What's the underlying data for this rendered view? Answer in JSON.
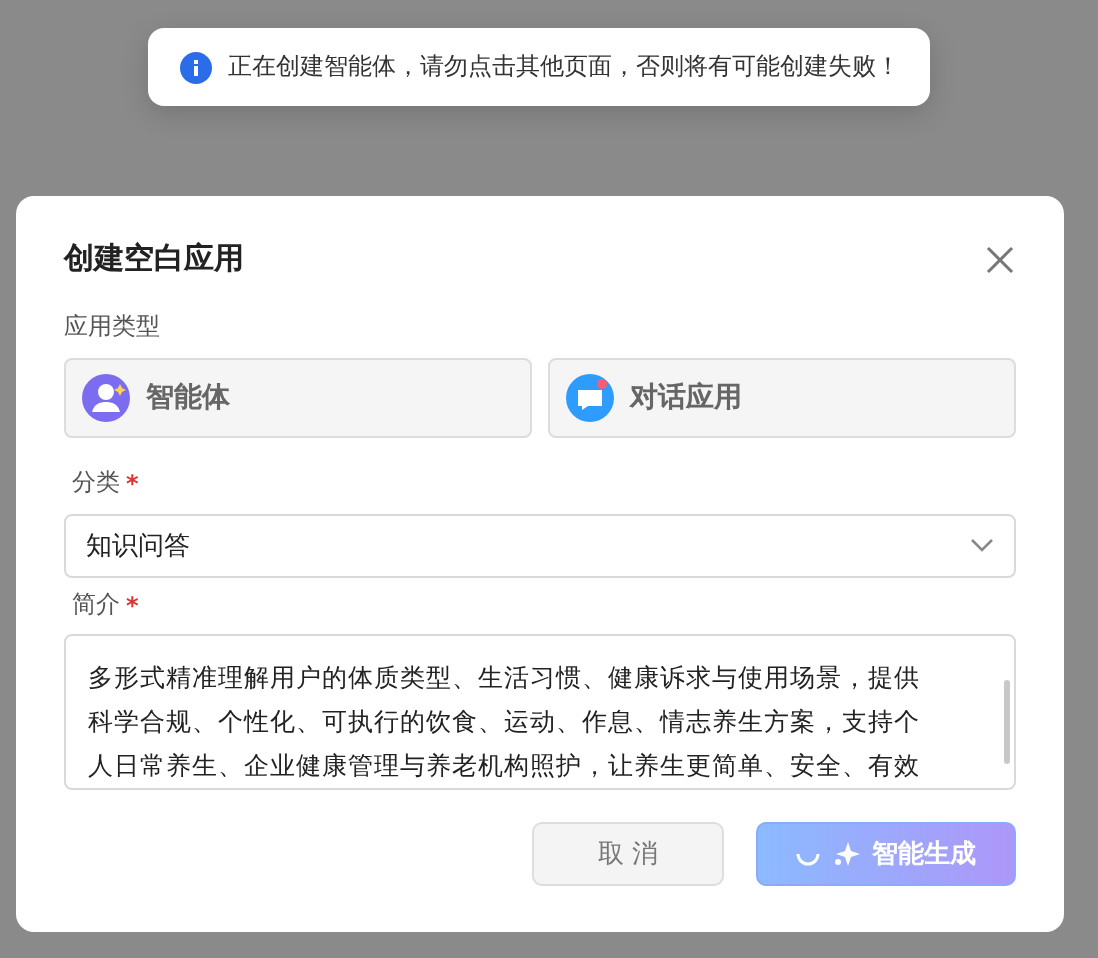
{
  "toast": {
    "message": "正在创建智能体，请勿点击其他页面，否则将有可能创建失败！"
  },
  "dialog": {
    "title": "创建空白应用",
    "app_type": {
      "label": "应用类型",
      "options": [
        {
          "kind": "agent",
          "label": "智能体",
          "selected": false
        },
        {
          "kind": "chat",
          "label": "对话应用",
          "selected": false
        }
      ]
    },
    "category": {
      "label": "分类",
      "required_mark": "*",
      "value": "知识问答"
    },
    "description": {
      "label": "简介",
      "required_mark": "*",
      "lines": [
        "多形式精准理解用户的体质类型、生活习惯、健康诉求与使用场景，提供",
        "科学合规、个性化、可执行的饮食、运动、作息、情志养生方案，支持个",
        "人日常养生、企业健康管理与养老机构照护，让养生更简单、安全、有效"
      ]
    },
    "buttons": [
      {
        "kind": "cancel",
        "label": "取 消"
      },
      {
        "kind": "generate",
        "label": "智能生成",
        "loading": true
      }
    ]
  }
}
